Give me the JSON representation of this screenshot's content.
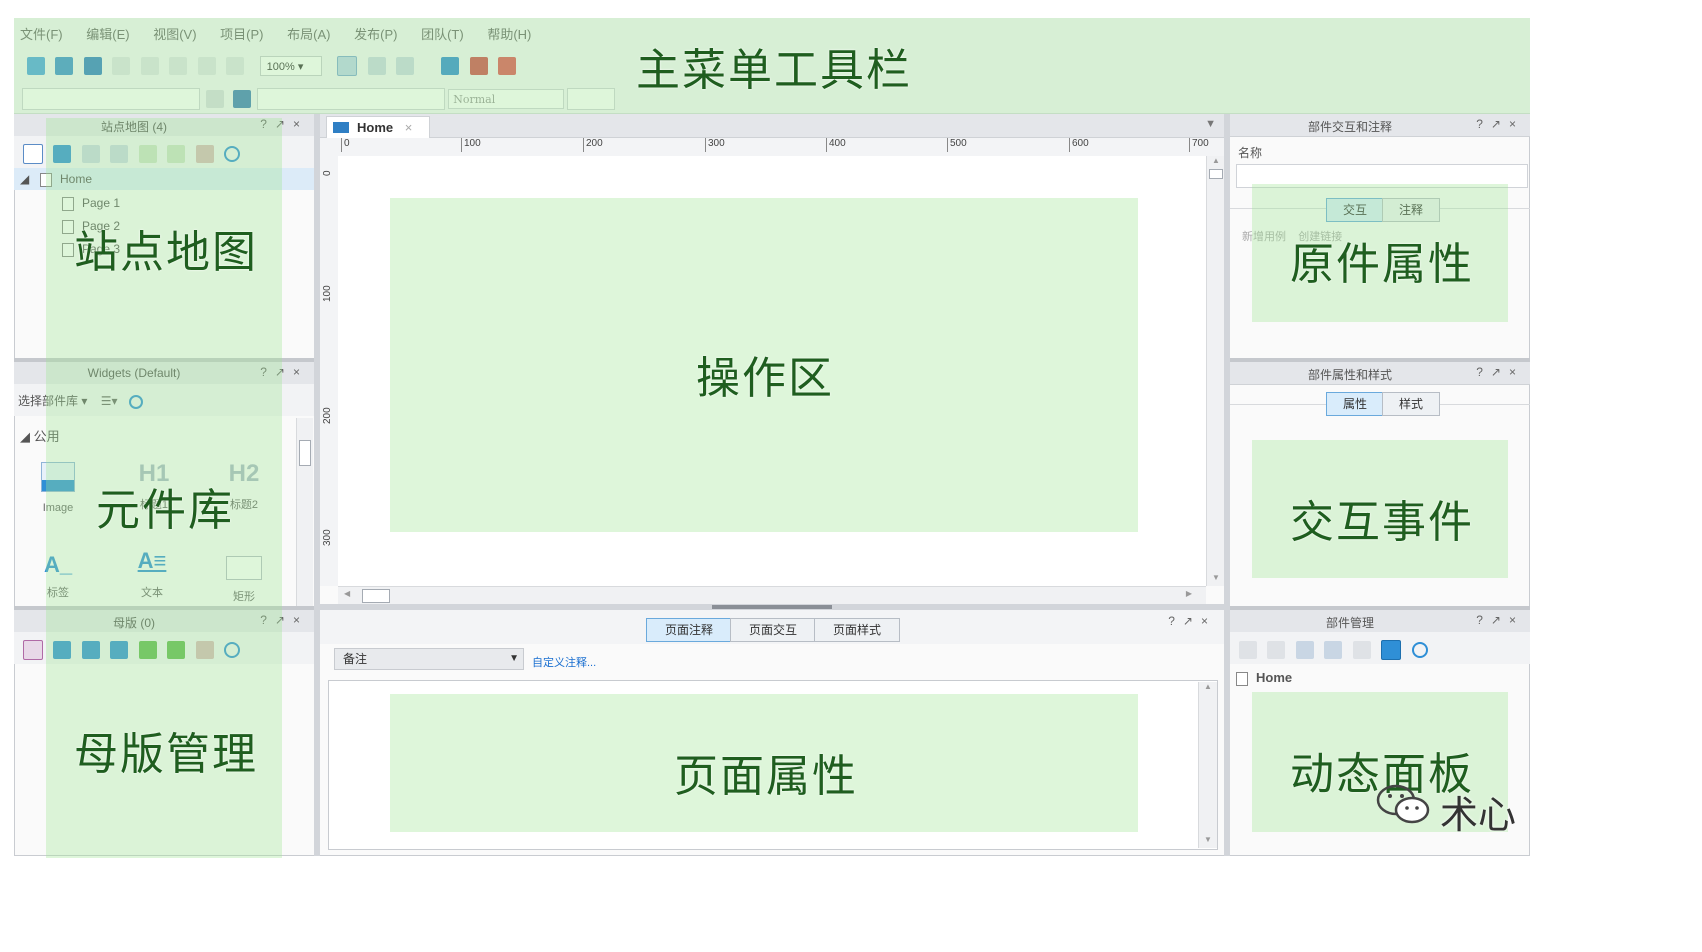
{
  "menu": [
    "文件(F)",
    "编辑(E)",
    "视图(V)",
    "项目(P)",
    "布局(A)",
    "发布(P)",
    "团队(T)",
    "帮助(H)"
  ],
  "toolbar": {
    "zoom": "100%",
    "font_style": "Normal"
  },
  "regions": {
    "toolbar": "主菜单工具栏",
    "sitemap": "站点地图",
    "widgets": "元件库",
    "masters": "母版管理",
    "canvas": "操作区",
    "page_props": "页面属性",
    "widget_props": "原件属性",
    "interaction": "交互事件",
    "dynamic": "动态面板"
  },
  "sitemap": {
    "title": "站点地图 (4)",
    "root": "Home",
    "pages": [
      "Page 1",
      "Page 2",
      "Page 3"
    ]
  },
  "widgets_panel": {
    "title": "Widgets (Default)",
    "select_label": "选择部件库",
    "group": "公用",
    "items": [
      {
        "glyph": "",
        "label": "Image"
      },
      {
        "glyph": "H1",
        "label": "标题1"
      },
      {
        "glyph": "H2",
        "label": "标题2"
      },
      {
        "glyph": "A_",
        "label": "标签"
      },
      {
        "glyph": "A≡",
        "label": "文本"
      },
      {
        "glyph": "",
        "label": "矩形"
      }
    ]
  },
  "masters": {
    "title": "母版 (0)"
  },
  "canvas": {
    "tab": "Home",
    "ruler_x": [
      "0",
      "100",
      "200",
      "300",
      "400",
      "500",
      "600",
      "700"
    ],
    "ruler_y": [
      "0",
      "100",
      "200",
      "300"
    ]
  },
  "page_panel": {
    "tabs": [
      "页面注释",
      "页面交互",
      "页面样式"
    ],
    "select": "备注",
    "custom_link": "自定义注释..."
  },
  "interact_panel": {
    "title": "部件交互和注释",
    "name_label": "名称",
    "tabs": [
      "交互",
      "注释"
    ],
    "hint": "新增用例    创建链接"
  },
  "style_panel": {
    "title": "部件属性和样式",
    "tabs": [
      "属性",
      "样式"
    ]
  },
  "manage_panel": {
    "title": "部件管理",
    "root": "Home"
  },
  "watermark": "术心",
  "colors": {
    "overlay": "#a0e696",
    "accent_text": "#1f5e1f",
    "link": "#1a6fd0",
    "tab_active": "#d9ecfb"
  }
}
